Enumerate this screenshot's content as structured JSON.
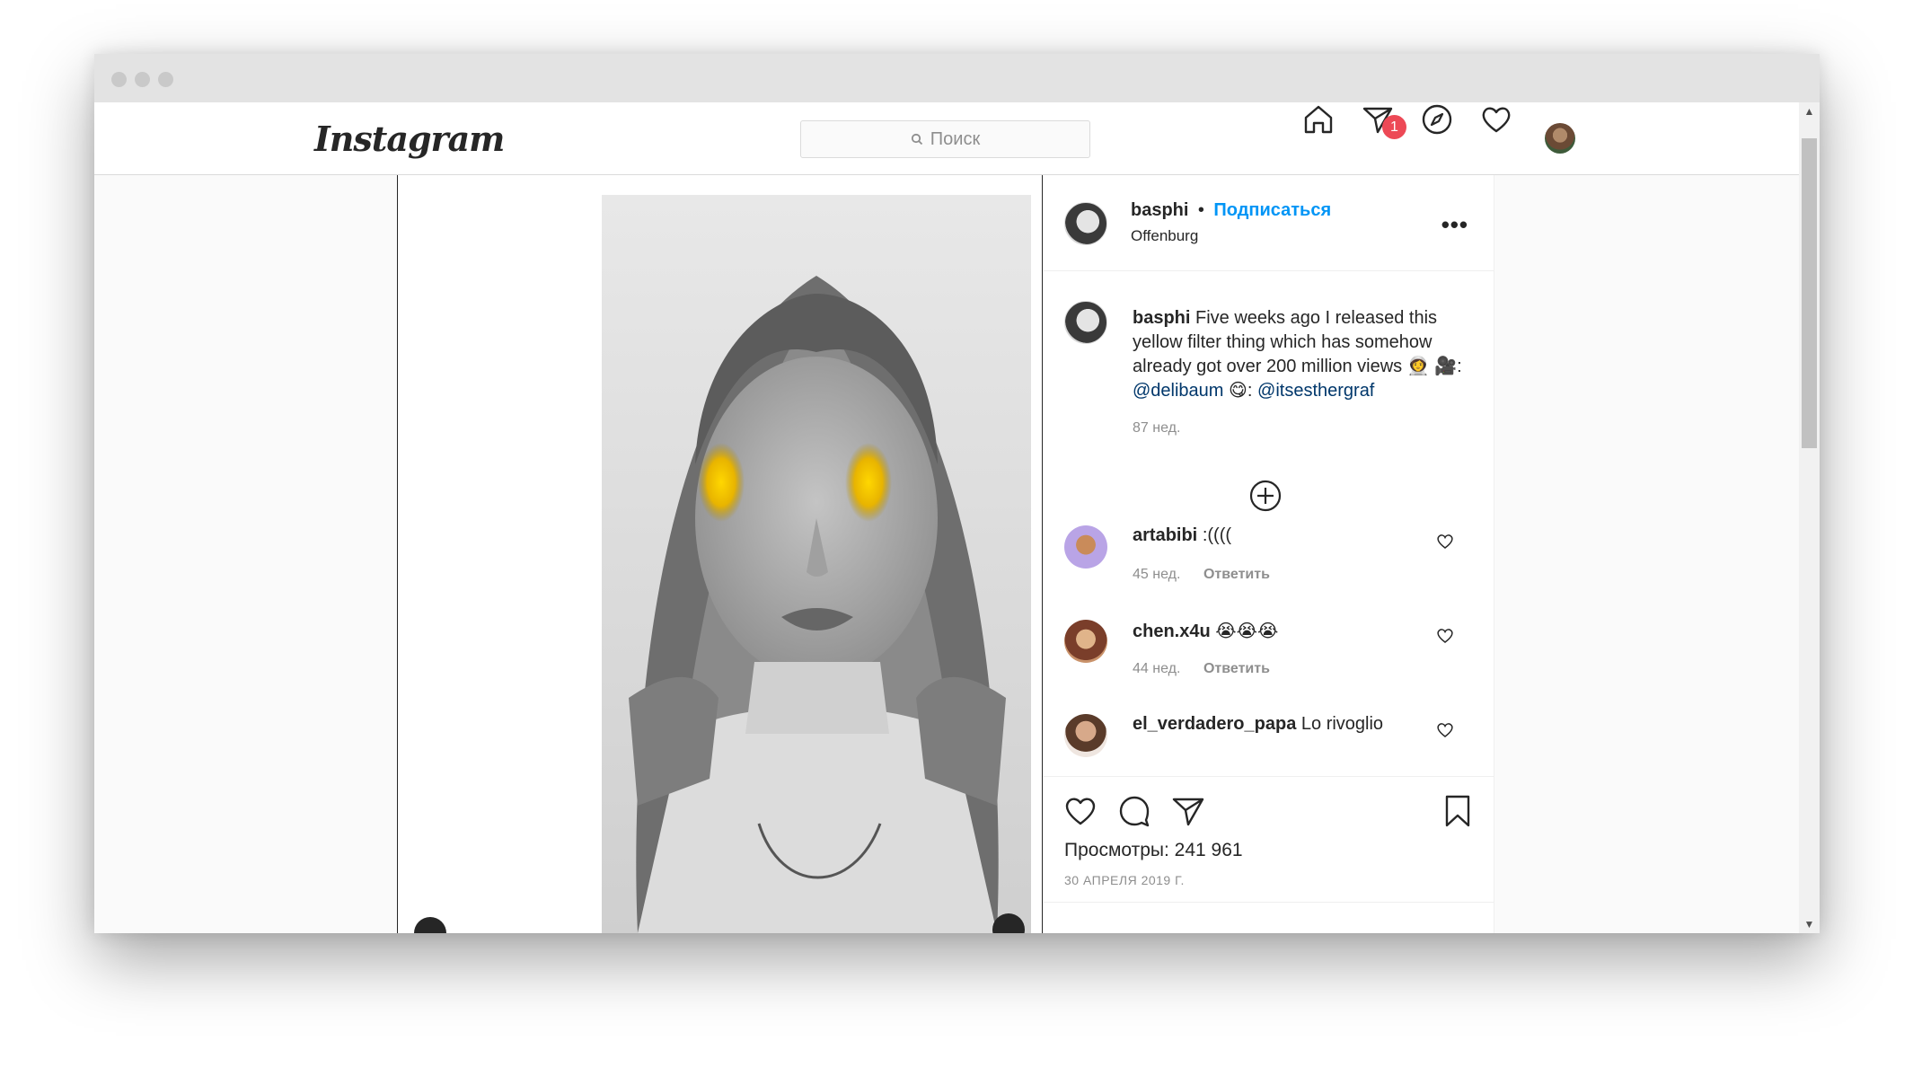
{
  "header": {
    "logo": "Instagram",
    "search_placeholder": "Поиск",
    "notification_count": "1"
  },
  "post": {
    "author": "basphi",
    "follow_label": "Подписаться",
    "location": "Offenburg",
    "more_label": "•••",
    "caption": {
      "author": "basphi",
      "text": "Five weeks ago I released this yellow filter thing which has somehow already got over 200 million views",
      "emoji_1": "👩‍🚀",
      "emoji_2": "🎥",
      "mention_1": "@delibaum",
      "emoji_3": "😋",
      "mention_2": "@itsesthergraf",
      "age": "87 нед."
    },
    "comments": [
      {
        "user": "artabibi",
        "text": ":((((",
        "age": "45 нед.",
        "reply": "Ответить"
      },
      {
        "user": "chen.x4u",
        "text": "😭😭😭",
        "age": "44 нед.",
        "reply": "Ответить"
      },
      {
        "user": "el_verdadero_papa",
        "text": "Lo rivoglio",
        "age": "",
        "reply": ""
      }
    ],
    "views_label": "Просмотры: 241 961",
    "date": "30 АПРЕЛЯ 2019 Г."
  },
  "icons": [
    "home-icon",
    "direct-icon",
    "explore-icon",
    "activity-heart-icon",
    "like-icon",
    "comment-icon",
    "share-icon",
    "save-icon",
    "add-comment-icon"
  ],
  "colors": {
    "link": "#0095f6",
    "mention": "#00376b",
    "badge": "#ed4956",
    "filter": "#f2c200"
  }
}
